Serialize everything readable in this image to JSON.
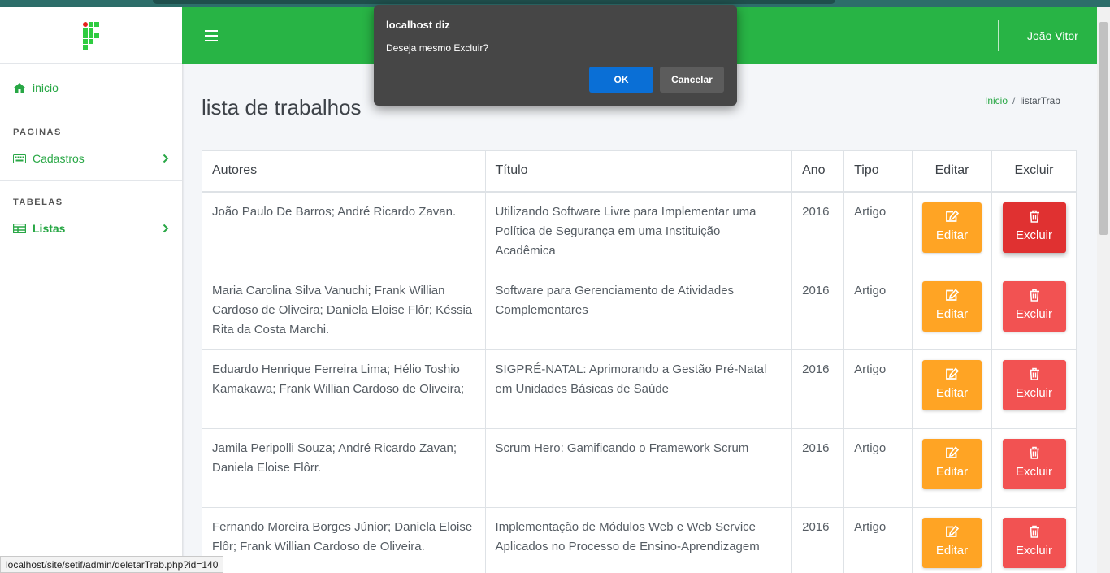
{
  "sidebar": {
    "home_label": "inicio",
    "section_pages": "PAGINAS",
    "cadastros_label": "Cadastros",
    "section_tables": "TABELAS",
    "listas_label": "Listas"
  },
  "topbar": {
    "user_name": "João Vitor"
  },
  "main": {
    "title": "lista de trabalhos",
    "breadcrumb": {
      "home": "Inicio",
      "current": "listarTrab"
    }
  },
  "table": {
    "headers": {
      "authors": "Autores",
      "title": "Título",
      "year": "Ano",
      "type": "Tipo",
      "edit": "Editar",
      "delete": "Excluir"
    },
    "button_edit": "Editar",
    "button_delete": "Excluir",
    "rows": [
      {
        "authors": "João Paulo De Barros; André Ricardo Zavan.",
        "title": "Utilizando Software Livre para Implementar uma Política de Segurança em uma Instituição Acadêmica",
        "year": "2016",
        "type": "Artigo"
      },
      {
        "authors": "Maria Carolina Silva Vanuchi; Frank Willian Cardoso de Oliveira; Daniela Eloise Flôr; Késsia Rita da Costa Marchi.",
        "title": "Software para Gerenciamento de Atividades Complementares",
        "year": "2016",
        "type": "Artigo"
      },
      {
        "authors": "Eduardo Henrique Ferreira Lima; Hélio Toshio Kamakawa; Frank Willian Cardoso de Oliveira;",
        "title": "SIGPRÉ-NATAL: Aprimorando a Gestão Pré-Natal em Unidades Básicas de Saúde",
        "year": "2016",
        "type": "Artigo"
      },
      {
        "authors": "Jamila Peripolli Souza; André Ricardo Zavan; Daniela Eloise Flôrr.",
        "title": "Scrum Hero: Gamificando o Framework Scrum",
        "year": "2016",
        "type": "Artigo"
      },
      {
        "authors": "Fernando Moreira Borges Júnior; Daniela Eloise Flôr; Frank Willian Cardoso de Oliveira.",
        "title": "Implementação de Módulos Web e Web Service Aplicados no Processo de Ensino-Aprendizagem",
        "year": "2016",
        "type": "Artigo"
      }
    ]
  },
  "dialog": {
    "title": "localhost diz",
    "message": "Deseja mesmo Excluir?",
    "ok_label": "OK",
    "cancel_label": "Cancelar"
  },
  "statusbar": {
    "url": "localhost/site/setif/admin/deletarTrab.php?id=140"
  },
  "colors": {
    "brand_green": "#28b445",
    "edit_orange": "#ffa424",
    "delete_red": "#f25252",
    "dialog_ok_blue": "#0a6fd6"
  }
}
